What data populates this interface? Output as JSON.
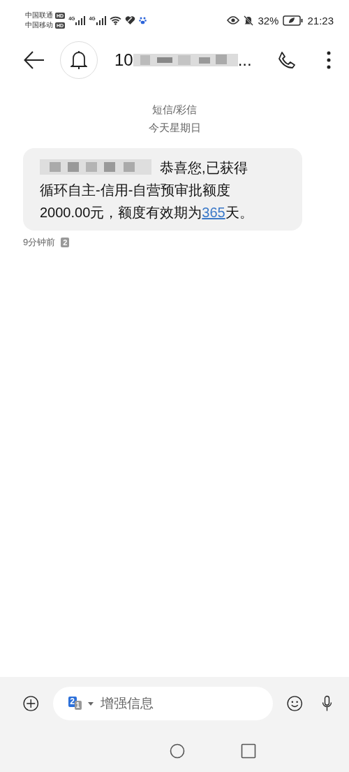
{
  "status_bar": {
    "carriers": [
      {
        "name": "中国联通",
        "badge": "HD"
      },
      {
        "name": "中国移动",
        "badge": "HD"
      }
    ],
    "networks": [
      {
        "label": "4G"
      },
      {
        "label": "4G"
      }
    ],
    "battery_percent": "32%",
    "time": "21:23"
  },
  "header": {
    "title_start": "10",
    "title_end": "..."
  },
  "thread": {
    "type": "短信/彩信",
    "day": "今天星期日",
    "messages": [
      {
        "text_before": "恭喜您,已获得循环自主-信用-自营预审批额度2000.00元，额度有效期为",
        "link": "365",
        "text_after": "天。",
        "time": "9分钟前",
        "sim": "2"
      }
    ]
  },
  "composer": {
    "sim_primary": "2",
    "sim_secondary": "1",
    "placeholder": "增强信息"
  }
}
